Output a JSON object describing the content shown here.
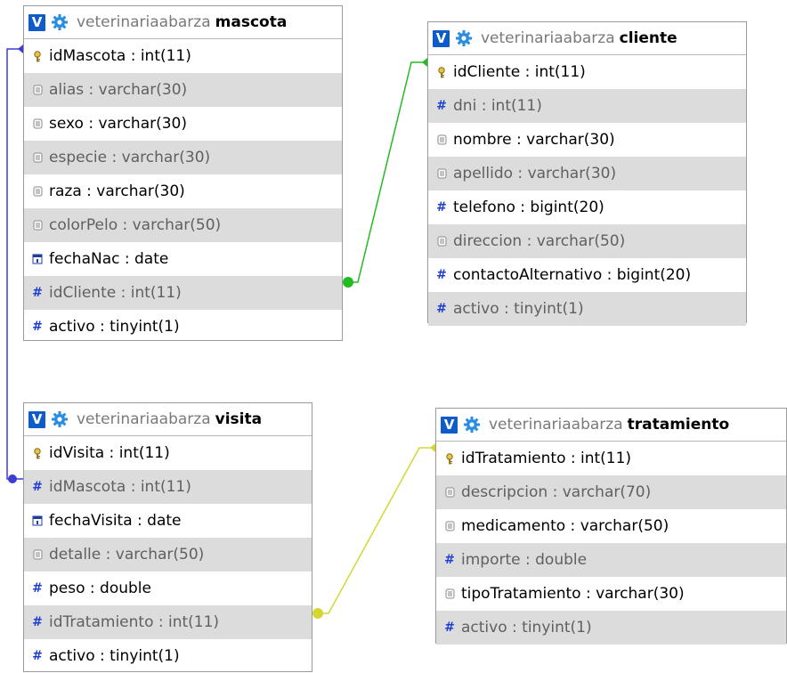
{
  "colors": {
    "header_toggle": "#0e5bc9",
    "gear": "#2a8ee0",
    "alt_row": "#dcdcdc",
    "relation_mascota_visita": "#3b3bd6",
    "relation_cliente_mascota": "#22bb22",
    "relation_tratamiento_visita": "#d6d633"
  },
  "icons": {
    "toggle_label": "V",
    "key": "key-icon",
    "text": "text-field-icon",
    "number": "#",
    "date": "date-field-icon"
  },
  "tables": {
    "mascota": {
      "database": "veterinariaabarza",
      "name": "mascota",
      "columns": [
        {
          "icon": "key",
          "label": "idMascota : int(11)"
        },
        {
          "icon": "text",
          "label": "alias : varchar(30)"
        },
        {
          "icon": "text",
          "label": "sexo : varchar(30)"
        },
        {
          "icon": "text",
          "label": "especie : varchar(30)"
        },
        {
          "icon": "text",
          "label": "raza : varchar(30)"
        },
        {
          "icon": "text",
          "label": "colorPelo : varchar(50)"
        },
        {
          "icon": "date",
          "label": "fechaNac : date"
        },
        {
          "icon": "number",
          "label": "idCliente : int(11)"
        },
        {
          "icon": "number",
          "label": "activo : tinyint(1)"
        }
      ]
    },
    "cliente": {
      "database": "veterinariaabarza",
      "name": "cliente",
      "columns": [
        {
          "icon": "key",
          "label": "idCliente : int(11)"
        },
        {
          "icon": "number",
          "label": "dni : int(11)"
        },
        {
          "icon": "text",
          "label": "nombre : varchar(30)"
        },
        {
          "icon": "text",
          "label": "apellido : varchar(30)"
        },
        {
          "icon": "number",
          "label": "telefono : bigint(20)"
        },
        {
          "icon": "text",
          "label": "direccion : varchar(50)"
        },
        {
          "icon": "number",
          "label": "contactoAlternativo : bigint(20)"
        },
        {
          "icon": "number",
          "label": "activo : tinyint(1)"
        }
      ]
    },
    "visita": {
      "database": "veterinariaabarza",
      "name": "visita",
      "columns": [
        {
          "icon": "key",
          "label": "idVisita : int(11)"
        },
        {
          "icon": "number",
          "label": "idMascota : int(11)"
        },
        {
          "icon": "date",
          "label": "fechaVisita : date"
        },
        {
          "icon": "text",
          "label": "detalle : varchar(50)"
        },
        {
          "icon": "number",
          "label": "peso : double"
        },
        {
          "icon": "number",
          "label": "idTratamiento : int(11)"
        },
        {
          "icon": "number",
          "label": "activo : tinyint(1)"
        }
      ]
    },
    "tratamiento": {
      "database": "veterinariaabarza",
      "name": "tratamiento",
      "columns": [
        {
          "icon": "key",
          "label": "idTratamiento : int(11)"
        },
        {
          "icon": "text",
          "label": "descripcion : varchar(70)"
        },
        {
          "icon": "text",
          "label": "medicamento : varchar(50)"
        },
        {
          "icon": "number",
          "label": "importe : double"
        },
        {
          "icon": "text",
          "label": "tipoTratamiento : varchar(30)"
        },
        {
          "icon": "number",
          "label": "activo : tinyint(1)"
        }
      ]
    }
  }
}
